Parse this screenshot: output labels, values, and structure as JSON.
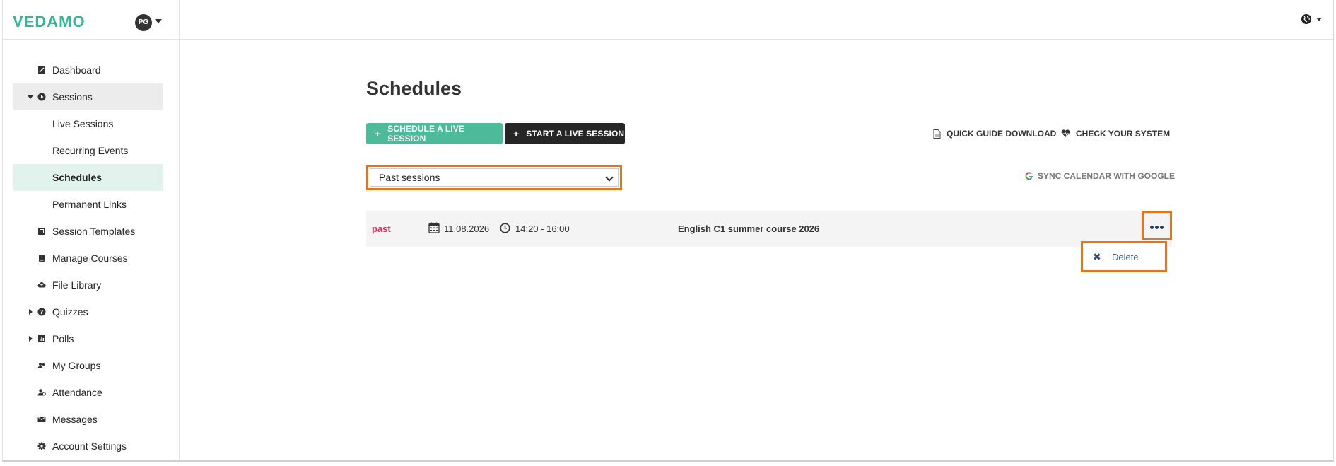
{
  "brand": {
    "logo": "VEDAMO",
    "avatar_initials": "PG"
  },
  "sidebar": {
    "items": [
      {
        "label": "Dashboard",
        "icon": "dashboard-icon"
      },
      {
        "label": "Sessions",
        "icon": "play-circle-icon",
        "expanded": true
      },
      {
        "label": "Live Sessions"
      },
      {
        "label": "Recurring Events"
      },
      {
        "label": "Schedules",
        "active": true
      },
      {
        "label": "Permanent Links"
      },
      {
        "label": "Session Templates",
        "icon": "template-icon"
      },
      {
        "label": "Manage Courses",
        "icon": "book-icon"
      },
      {
        "label": "File Library",
        "icon": "cloud-icon"
      },
      {
        "label": "Quizzes",
        "icon": "question-circle-icon",
        "collapsed": true
      },
      {
        "label": "Polls",
        "icon": "chart-icon",
        "collapsed": true
      },
      {
        "label": "My Groups",
        "icon": "users-icon"
      },
      {
        "label": "Attendance",
        "icon": "user-check-icon"
      },
      {
        "label": "Messages",
        "icon": "envelope-icon"
      },
      {
        "label": "Account Settings",
        "icon": "gear-icon"
      }
    ]
  },
  "main": {
    "title": "Schedules",
    "buttons": {
      "schedule": "SCHEDULE A LIVE SESSION",
      "start": "START A LIVE SESSION"
    },
    "links": {
      "quick_guide": "QUICK GUIDE DOWNLOAD",
      "check_system": "CHECK YOUR SYSTEM",
      "sync": "SYNC CALENDAR WITH GOOGLE"
    },
    "filter": {
      "selected": "Past sessions"
    },
    "sessions": [
      {
        "status": "past",
        "date": "11.08.2026",
        "time": "14:20 - 16:00",
        "title": "English C1 summer course 2026"
      }
    ],
    "menu": {
      "delete": "Delete"
    }
  },
  "colors": {
    "accent": "#4dbb9a",
    "brand": "#35b694",
    "highlight": "#e8741a",
    "past": "#e0244d"
  }
}
